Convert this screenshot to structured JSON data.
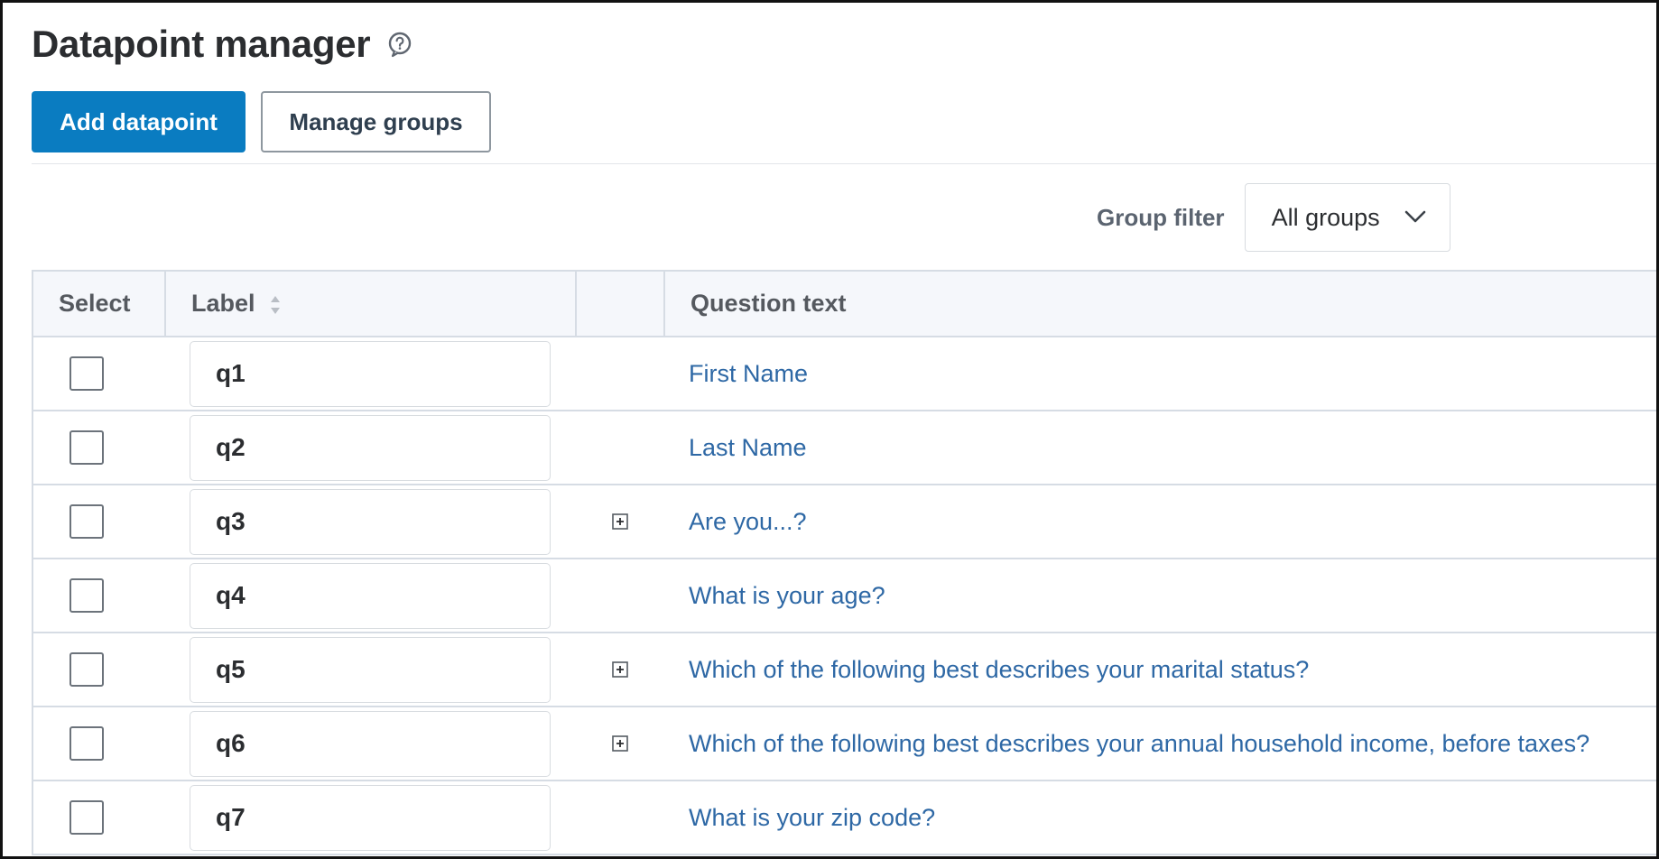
{
  "page": {
    "title": "Datapoint manager",
    "help_icon": "question-circle-icon"
  },
  "toolbar": {
    "add_label": "Add datapoint",
    "manage_label": "Manage groups"
  },
  "filter": {
    "label": "Group filter",
    "selected": "All groups",
    "icon": "chevron-down-icon"
  },
  "colors": {
    "primary": "#0a7cc1",
    "link": "#2e68a5",
    "header_bg": "#f5f7fb"
  },
  "table": {
    "headers": {
      "select": "Select",
      "label": "Label",
      "expand": "",
      "question": "Question text"
    },
    "rows": [
      {
        "label": "q1",
        "expandable": false,
        "question": "First Name"
      },
      {
        "label": "q2",
        "expandable": false,
        "question": "Last Name"
      },
      {
        "label": "q3",
        "expandable": true,
        "question": "Are you...?"
      },
      {
        "label": "q4",
        "expandable": false,
        "question": "What is your age?"
      },
      {
        "label": "q5",
        "expandable": true,
        "question": "Which of the following best describes your marital status?"
      },
      {
        "label": "q6",
        "expandable": true,
        "question": "Which of the following best describes your annual household income, before taxes?"
      },
      {
        "label": "q7",
        "expandable": false,
        "question": "What is your zip code?"
      }
    ]
  }
}
